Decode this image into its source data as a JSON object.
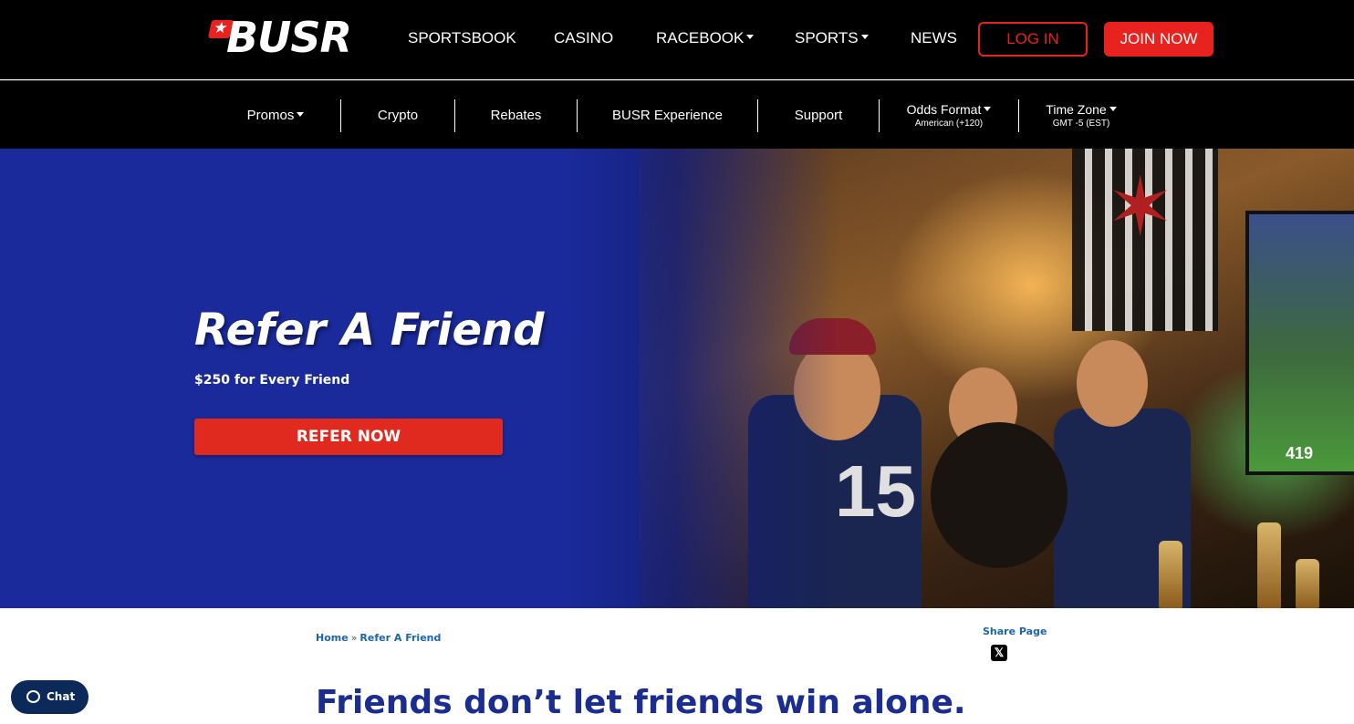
{
  "header": {
    "logo_text": "BUSR",
    "nav": [
      {
        "label": "SPORTSBOOK",
        "dropdown": false
      },
      {
        "label": "CASINO",
        "dropdown": false
      },
      {
        "label": "RACEBOOK",
        "dropdown": true
      },
      {
        "label": "SPORTS",
        "dropdown": true
      },
      {
        "label": "NEWS",
        "dropdown": false
      }
    ],
    "login_label": "LOG IN",
    "join_label": "JOIN NOW"
  },
  "subnav": {
    "items": [
      {
        "label": "Promos",
        "dropdown": true
      },
      {
        "label": "Crypto"
      },
      {
        "label": "Rebates"
      },
      {
        "label": "BUSR Experience"
      },
      {
        "label": "Support"
      }
    ],
    "odds_format": {
      "label": "Odds Format",
      "value": "American (+120)"
    },
    "time_zone": {
      "label": "Time Zone",
      "value": "GMT -5 (EST)"
    }
  },
  "hero": {
    "title": "Refer A Friend",
    "subtitle": "$250 for Every Friend",
    "cta_label": "REFER NOW",
    "tv_score": "419"
  },
  "breadcrumb": {
    "home": "Home",
    "separator": "»",
    "current": "Refer A Friend"
  },
  "share": {
    "label": "Share Page",
    "x_icon": "x-icon"
  },
  "content": {
    "headline": "Friends don’t let friends win alone."
  },
  "chat": {
    "label": "Chat"
  },
  "colors": {
    "brand_red": "#e8231f",
    "hero_blue": "#1b2d9c",
    "headline_blue": "#1b2d8f",
    "link_blue": "#1a66a8",
    "chat_navy": "#0b2a5a"
  }
}
